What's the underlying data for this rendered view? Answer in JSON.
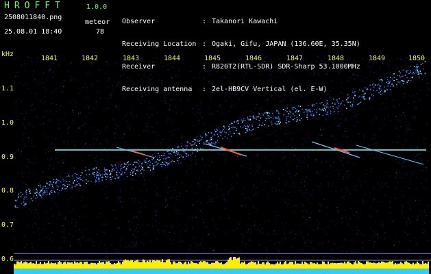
{
  "header": {
    "app_name": "HROFFT",
    "version": "1.0.0",
    "filename": "2508011840.png",
    "datetime": "25.08.01 18:40",
    "meteor_label": "meteor",
    "meteor_count": "78"
  },
  "info": [
    {
      "key": "Observer",
      "value": "Takanori Kawachi"
    },
    {
      "key": "Receiving Location",
      "value": "Ogaki, Gifu, JAPAN (136.60E, 35.35N)"
    },
    {
      "key": "Receiver",
      "value": "R820T2(RTL-SDR) SDR-Sharp 53.1000MHz"
    },
    {
      "key": "Receiving antenna",
      "value": "2el-HB9CV Vertical (el. E-W)"
    }
  ],
  "axes": {
    "y_unit": "kHz",
    "x_ticks": [
      "1841",
      "1842",
      "1843",
      "1844",
      "1845",
      "1846",
      "1847",
      "1848",
      "1849",
      "1850"
    ],
    "y_ticks": [
      "1.1",
      "1.0",
      "0.9",
      "0.8",
      "0.7",
      "0.6"
    ]
  },
  "colors": {
    "background": "#000000",
    "label_green": "#66ff66",
    "label_yellow": "#ffff33",
    "noise_blue": "#1a1aa0",
    "level_yellow": "#ffee00",
    "level_cyan": "#33ccff"
  }
}
